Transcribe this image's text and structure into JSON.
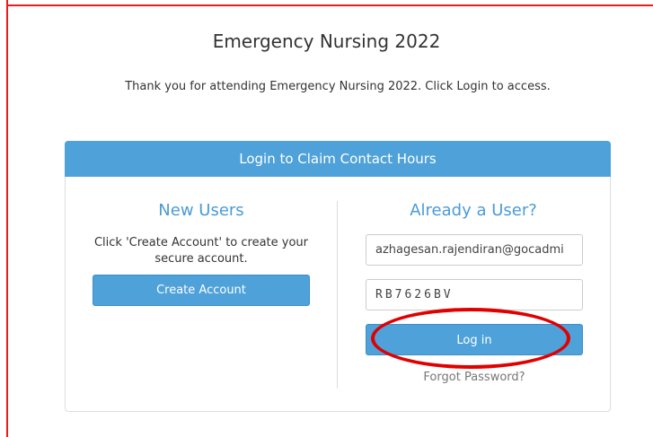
{
  "page": {
    "title": "Emergency Nursing 2022",
    "intro": "Thank you for attending Emergency Nursing 2022. Click Login to access."
  },
  "panel": {
    "header": "Login to Claim Contact Hours"
  },
  "new_users": {
    "heading": "New Users",
    "description": "Click 'Create Account' to create your secure account.",
    "create_button": "Create Account"
  },
  "existing_user": {
    "heading": "Already a User?",
    "email_value": "azhagesan.rajendiran@gocadmi",
    "password_value": "RB7626BV",
    "login_button": "Log in",
    "forgot_link": "Forgot Password?"
  },
  "colors": {
    "accent": "#4ea1d9",
    "heading_accent": "#4a9bd6",
    "annotation": "#e00000"
  }
}
